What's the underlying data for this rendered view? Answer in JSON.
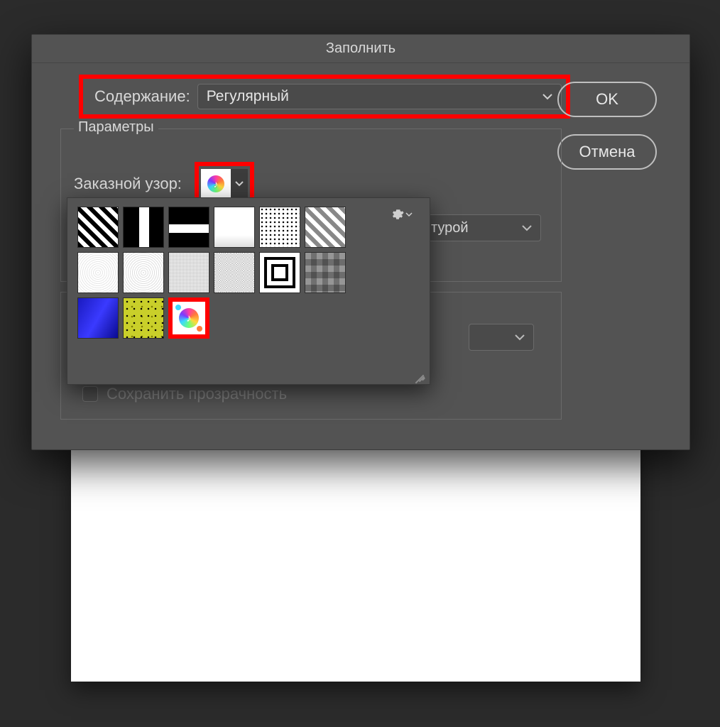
{
  "dialog": {
    "title": "Заполнить",
    "content_label": "Содержание:",
    "content_value": "Регулярный",
    "ok": "OK",
    "cancel": "Отмена"
  },
  "params": {
    "legend": "Параметры",
    "pattern_label": "Заказной узор:",
    "partial_select_text": "турой"
  },
  "preserve": {
    "label": "Сохранить прозрачность"
  },
  "patterns": [
    {
      "name": "diagonal-stripe"
    },
    {
      "name": "vertical-bar"
    },
    {
      "name": "horizontal-bar"
    },
    {
      "name": "white-gradient"
    },
    {
      "name": "halftone-dots"
    },
    {
      "name": "diagonal-stripe-gray"
    },
    {
      "name": "noise-fine-1"
    },
    {
      "name": "noise-fine-2"
    },
    {
      "name": "noise-fine-3"
    },
    {
      "name": "noise-fine-4"
    },
    {
      "name": "concentric-squares"
    },
    {
      "name": "camo-gray"
    },
    {
      "name": "blue-waves"
    },
    {
      "name": "yellow-speckle"
    },
    {
      "name": "music-app-icon"
    }
  ],
  "selected_pattern": "music-app-icon"
}
